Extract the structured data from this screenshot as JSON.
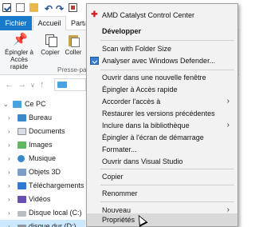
{
  "ribbon": {
    "tabs": {
      "file": "Fichier",
      "home": "Accueil",
      "share": "Partage"
    },
    "buttons": {
      "pin": "Épingler à Accès rapide",
      "copy": "Copier",
      "paste": "Coller"
    },
    "group_label": "Presse-papiers"
  },
  "nav_tree": [
    {
      "label": "Ce PC",
      "icon": "computer-icon"
    },
    {
      "label": "Bureau",
      "icon": "desktop-icon"
    },
    {
      "label": "Documents",
      "icon": "documents-icon"
    },
    {
      "label": "Images",
      "icon": "images-icon"
    },
    {
      "label": "Musique",
      "icon": "music-icon"
    },
    {
      "label": "Objets 3D",
      "icon": "3d-objects-icon"
    },
    {
      "label": "Téléchargements",
      "icon": "downloads-icon"
    },
    {
      "label": "Vidéos",
      "icon": "videos-icon"
    },
    {
      "label": "Disque local (C:)",
      "icon": "drive-icon"
    },
    {
      "label": "disque dur (D:)",
      "icon": "drive-icon",
      "selected": true
    }
  ],
  "context_menu": {
    "amd": "AMD Catalyst Control Center",
    "develop": "Développer",
    "scan": "Scan with Folder Size",
    "defender": "Analyser avec Windows Defender...",
    "open_new_window": "Ouvrir dans une nouvelle fenêtre",
    "pin_quick": "Épingler à Accès rapide",
    "grant_access": "Accorder l'accès à",
    "restore": "Restaurer les versions précédentes",
    "include_library": "Inclure dans la bibliothèque",
    "pin_start": "Épingler à l'écran de démarrage",
    "format": "Formater...",
    "open_vs": "Ouvrir dans Visual Studio",
    "copy": "Copier",
    "rename": "Renommer",
    "new": "Nouveau",
    "properties": "Propriétés"
  },
  "colors": {
    "accent": "#1979ca",
    "menu_bg": "#f2f2f2",
    "selection": "#cce8ff"
  }
}
